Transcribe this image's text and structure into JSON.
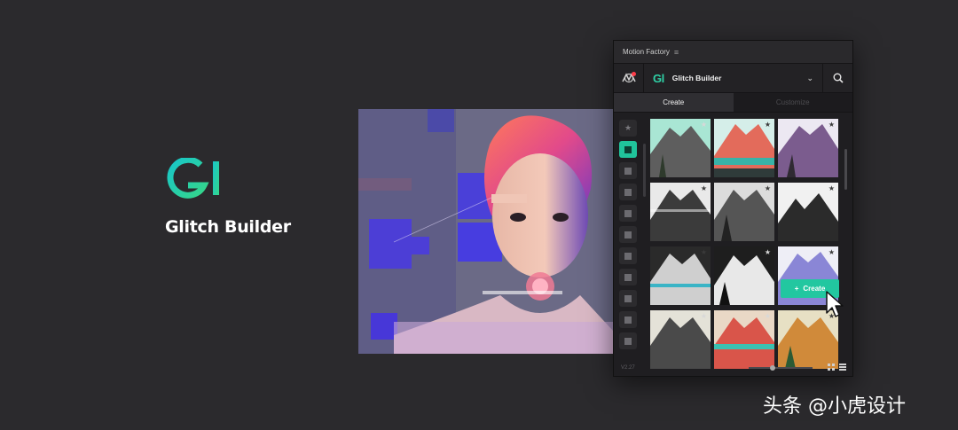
{
  "logo": {
    "mark": "Gl",
    "name": "Glitch Builder"
  },
  "panel": {
    "title": "Motion Factory",
    "menu_icon": "≡",
    "header": {
      "plugin_mark": "Gl",
      "plugin_name": "Glitch Builder",
      "chevron": "⌄"
    },
    "tabs": [
      {
        "label": "Create"
      },
      {
        "label": "Customize"
      }
    ],
    "create_button": {
      "label": "Create",
      "icon": "+"
    },
    "footer": {
      "version": "V2.27",
      "zoom_level": 0.38
    }
  },
  "watermark": "头条 @小虎设计",
  "colors": {
    "accent": "#22c7a0",
    "notification": "#ff3d4a",
    "background": "#2b2a2d"
  },
  "icons": [
    "motion-factory-icon",
    "search-icon",
    "star-icon",
    "film-icon",
    "cursor-icon",
    "grid-view-icon",
    "list-view-icon"
  ]
}
